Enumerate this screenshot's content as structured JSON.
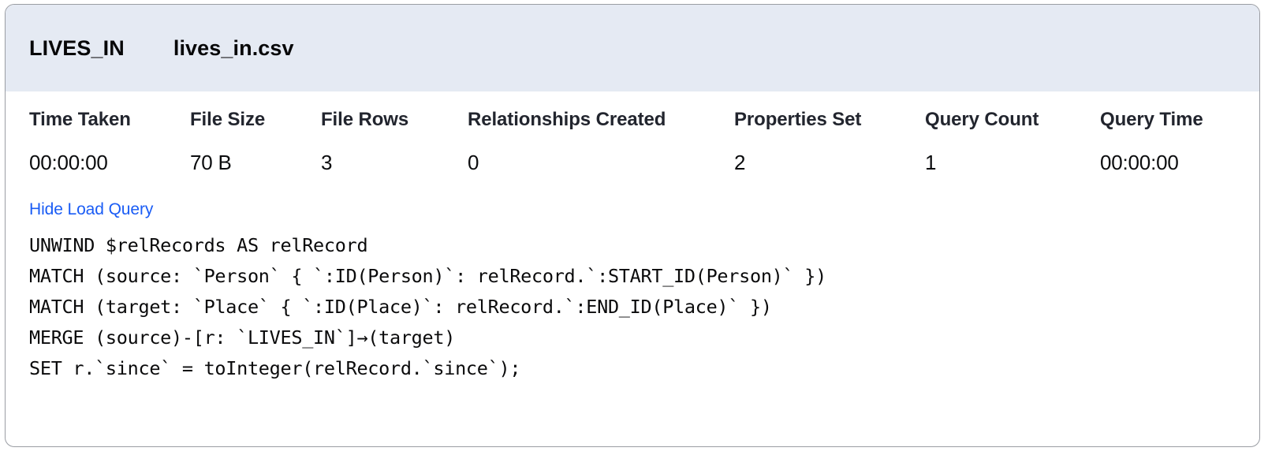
{
  "card": {
    "header": {
      "relationship_type": "LIVES_IN",
      "file_name": "lives_in.csv"
    },
    "stats": {
      "columns": [
        "Time Taken",
        "File Size",
        "File Rows",
        "Relationships Created",
        "Properties Set",
        "Query Count",
        "Query Time"
      ],
      "values": [
        "00:00:00",
        "70 B",
        "3",
        "0",
        "2",
        "1",
        "00:00:00"
      ]
    },
    "query": {
      "toggle_label": "Hide Load Query",
      "lines": [
        "UNWIND $relRecords AS relRecord",
        "MATCH (source: `Person` { `:ID(Person)`: relRecord.`:START_ID(Person)` })",
        "MATCH (target: `Place` { `:ID(Place)`: relRecord.`:END_ID(Place)` })",
        "MERGE (source)-[r: `LIVES_IN`]→(target)",
        "SET r.`since` = toInteger(relRecord.`since`);"
      ]
    }
  },
  "colors": {
    "header_background": "#e5eaf3",
    "card_border": "#9a9da3",
    "link": "#1a5cf5",
    "text": "#0b0c0e"
  }
}
